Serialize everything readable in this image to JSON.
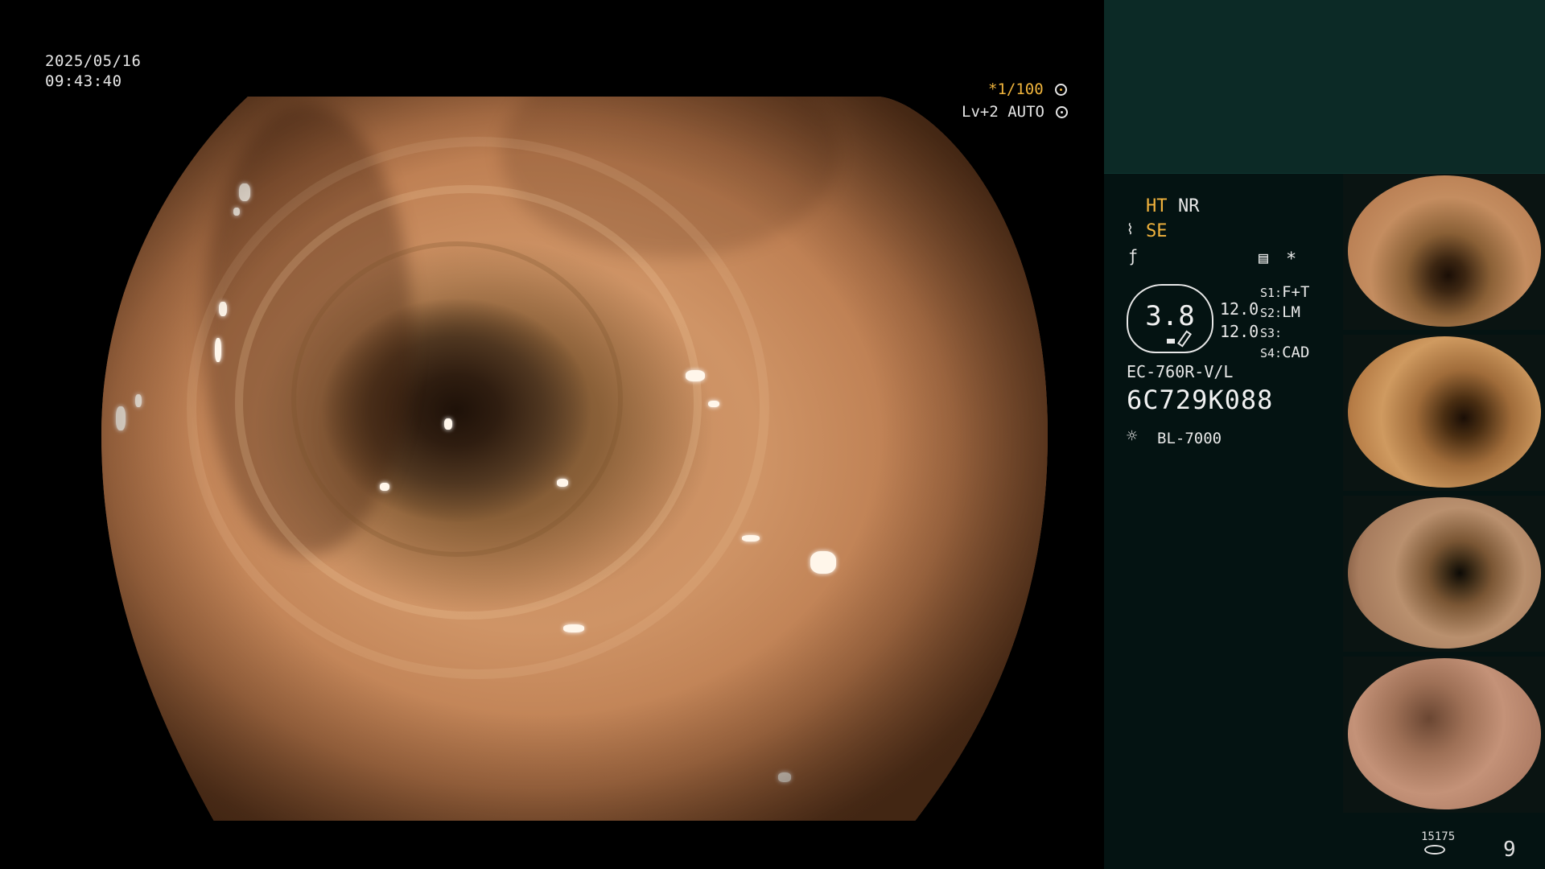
{
  "viewer": {
    "date": "2025/05/16",
    "time": "09:43:40",
    "shutter": "*1/100",
    "iris": "Lv+2 AUTO"
  },
  "panel": {
    "ht": "HT",
    "nr": "NR",
    "se": "SE",
    "star": "*",
    "gauge_value": "3.8",
    "val_top": "12.0",
    "val_bottom": "12.0",
    "s1_label": "S1:",
    "s1_value": "F+T",
    "s2_label": "S2:",
    "s2_value": "LM",
    "s3_label": "S3:",
    "s3_value": "",
    "s4_label": "S4:",
    "s4_value": "CAD",
    "scope_model": "EC-760R-V/L",
    "serial": "6C729K088",
    "light_source": "BL-7000"
  },
  "thumbnails": [
    {
      "label": "thumbnail-1"
    },
    {
      "label": "thumbnail-2"
    },
    {
      "label": "thumbnail-3"
    },
    {
      "label": "thumbnail-4"
    }
  ],
  "footer": {
    "count": "15175",
    "number": "9"
  },
  "colors": {
    "accent": "#f2b33d",
    "panel_bg": "#041312",
    "panel_top_bg": "#0c2a26"
  }
}
